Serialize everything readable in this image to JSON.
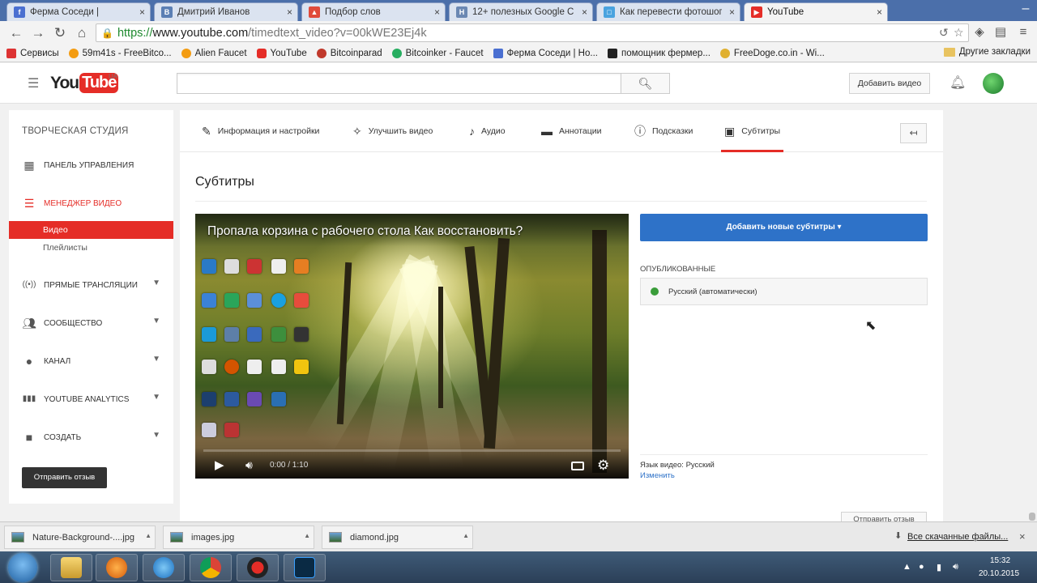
{
  "browser": {
    "tabs": [
      {
        "title": "Ферма Соседи |",
        "fav_color": "#4a6fd1",
        "fav_glyph": "f"
      },
      {
        "title": "Дмитрий Иванов",
        "fav_color": "#5b7fb4",
        "fav_glyph": "В"
      },
      {
        "title": "Подбор слов",
        "fav_color": "#e04a3a",
        "fav_glyph": "▲"
      },
      {
        "title": "12+ полезных Google C",
        "fav_color": "#6b88b3",
        "fav_glyph": "H"
      },
      {
        "title": "Как перевести фотошоп",
        "fav_color": "#4aa3df",
        "fav_glyph": "□"
      },
      {
        "title": "YouTube",
        "fav_color": "#e52d27",
        "fav_glyph": "▶",
        "active": true
      }
    ],
    "url_secure": "https://",
    "url_host": "www.youtube.com",
    "url_path": "/timedtext_video?v=00kWE23Ej4k",
    "bookmarks": [
      {
        "label": "Сервисы",
        "color": "#d33"
      },
      {
        "label": "59m41s - FreeBitco...",
        "color": "#f39c12"
      },
      {
        "label": "Alien Faucet",
        "color": "#f39c12"
      },
      {
        "label": "YouTube",
        "color": "#e52d27"
      },
      {
        "label": "Bitcoinparad",
        "color": "#c0392b"
      },
      {
        "label": "Bitcoinker - Faucet",
        "color": "#27ae60"
      },
      {
        "label": "Ферма Соседи | Но...",
        "color": "#4a6fd1"
      },
      {
        "label": "помощник фермер...",
        "color": "#222"
      },
      {
        "label": "FreeDoge.co.in - Wi...",
        "color": "#e0b030"
      }
    ],
    "bookmarks_other": "Другие закладки"
  },
  "youtube": {
    "logo_you": "You",
    "logo_tube": "Tube",
    "logo_region": "UA",
    "search_placeholder": "",
    "upload_label": "Добавить видео"
  },
  "sidebar": {
    "title": "ТВОРЧЕСКАЯ СТУДИЯ",
    "items": [
      {
        "label": "Панель управления",
        "icon": "dashboard-icon",
        "glyph": "▦"
      },
      {
        "label": "Менеджер видео",
        "icon": "video-manager-icon",
        "glyph": "☰",
        "active": true
      },
      {
        "label": "Прямые трансляции",
        "icon": "live-icon",
        "glyph": "((•))",
        "expand": true
      },
      {
        "label": "Сообщество",
        "icon": "community-icon",
        "glyph": "👥",
        "expand": true
      },
      {
        "label": "Канал",
        "icon": "channel-icon",
        "glyph": "●",
        "expand": true
      },
      {
        "label": "YouTube Analytics",
        "icon": "analytics-icon",
        "glyph": "▮▮",
        "expand": true
      },
      {
        "label": "Создать",
        "icon": "create-icon",
        "glyph": "■",
        "expand": true
      }
    ],
    "sub_items": [
      {
        "label": "Видео",
        "active": true
      },
      {
        "label": "Плейлисты"
      }
    ],
    "feedback_label": "Отправить отзыв"
  },
  "editor": {
    "tabs": [
      {
        "label": "Информация и настройки",
        "icon": "pencil-icon",
        "glyph": "✎"
      },
      {
        "label": "Улучшить видео",
        "icon": "magic-wand-icon",
        "glyph": "✧"
      },
      {
        "label": "Аудио",
        "icon": "music-note-icon",
        "glyph": "♪"
      },
      {
        "label": "Аннотации",
        "icon": "annotation-icon",
        "glyph": "▬"
      },
      {
        "label": "Подсказки",
        "icon": "info-icon",
        "glyph": "ⓘ"
      },
      {
        "label": "Субтитры",
        "icon": "cc-icon",
        "glyph": "▣",
        "active": true
      }
    ],
    "section_title": "Субтитры",
    "video": {
      "title": "Пропала корзина с рабочего стола Как восстановить?",
      "time": "0:00 / 1:10",
      "progress": 0.0
    },
    "add_subtitles_label": "Добавить новые субтитры ▾",
    "published_label": "ОПУБЛИКОВАННЫЕ",
    "published_items": [
      {
        "label": "Русский (автоматически)",
        "status_color": "#3a9d3a"
      }
    ],
    "video_language_label": "Язык видео: Русский",
    "change_link": "Изменить",
    "bottom_button": "Отправить отзыв"
  },
  "downloads": {
    "items": [
      "Nature-Background-....jpg",
      "images.jpg",
      "diamond.jpg"
    ],
    "all_label": "Все скачанные файлы..."
  },
  "taskbar": {
    "time": "15:32",
    "date": "20.10.2015"
  }
}
